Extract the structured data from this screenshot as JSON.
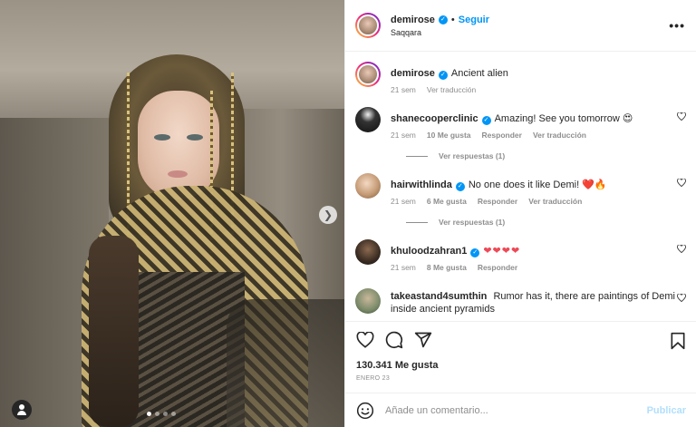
{
  "post": {
    "image_alt": "Woman wearing golden chain headpiece and chainmail in stone chamber",
    "slide_count": 4,
    "active_slide": 1
  },
  "header": {
    "username": "demirose",
    "follow_label": "Seguir",
    "location": "Saqqara",
    "separator": "•",
    "more": "•••"
  },
  "caption": {
    "username": "demirose",
    "text": "Ancient alien",
    "time": "21 sem",
    "translate": "Ver traducción"
  },
  "comments": [
    {
      "username": "shanecooperclinic",
      "text": "Amazing! See you tomorrow 😍",
      "time": "21 sem",
      "likes": "10 Me gusta",
      "reply": "Responder",
      "translate": "Ver traducción",
      "view_replies": "Ver respuestas (1)"
    },
    {
      "username": "hairwithlinda",
      "text": "No one does it like Demi! ❤️🔥",
      "time": "21 sem",
      "likes": "6 Me gusta",
      "reply": "Responder",
      "translate": "Ver traducción",
      "view_replies": "Ver respuestas (1)"
    },
    {
      "username": "khuloodzahran1",
      "text": "❤❤❤❤",
      "time": "21 sem",
      "likes": "8 Me gusta",
      "reply": "Responder"
    },
    {
      "username": "takeastand4sumthin",
      "text": "Rumor has it, there are paintings of Demi inside ancient pyramids"
    }
  ],
  "stats": {
    "likes": "130.341 Me gusta",
    "date": "ENERO 23"
  },
  "composer": {
    "placeholder": "Añade un comentario...",
    "publish_label": "Publicar"
  },
  "colors": {
    "accent": "#0095f6",
    "heart_red": "#ed4956",
    "muted": "#8e8e8e"
  }
}
